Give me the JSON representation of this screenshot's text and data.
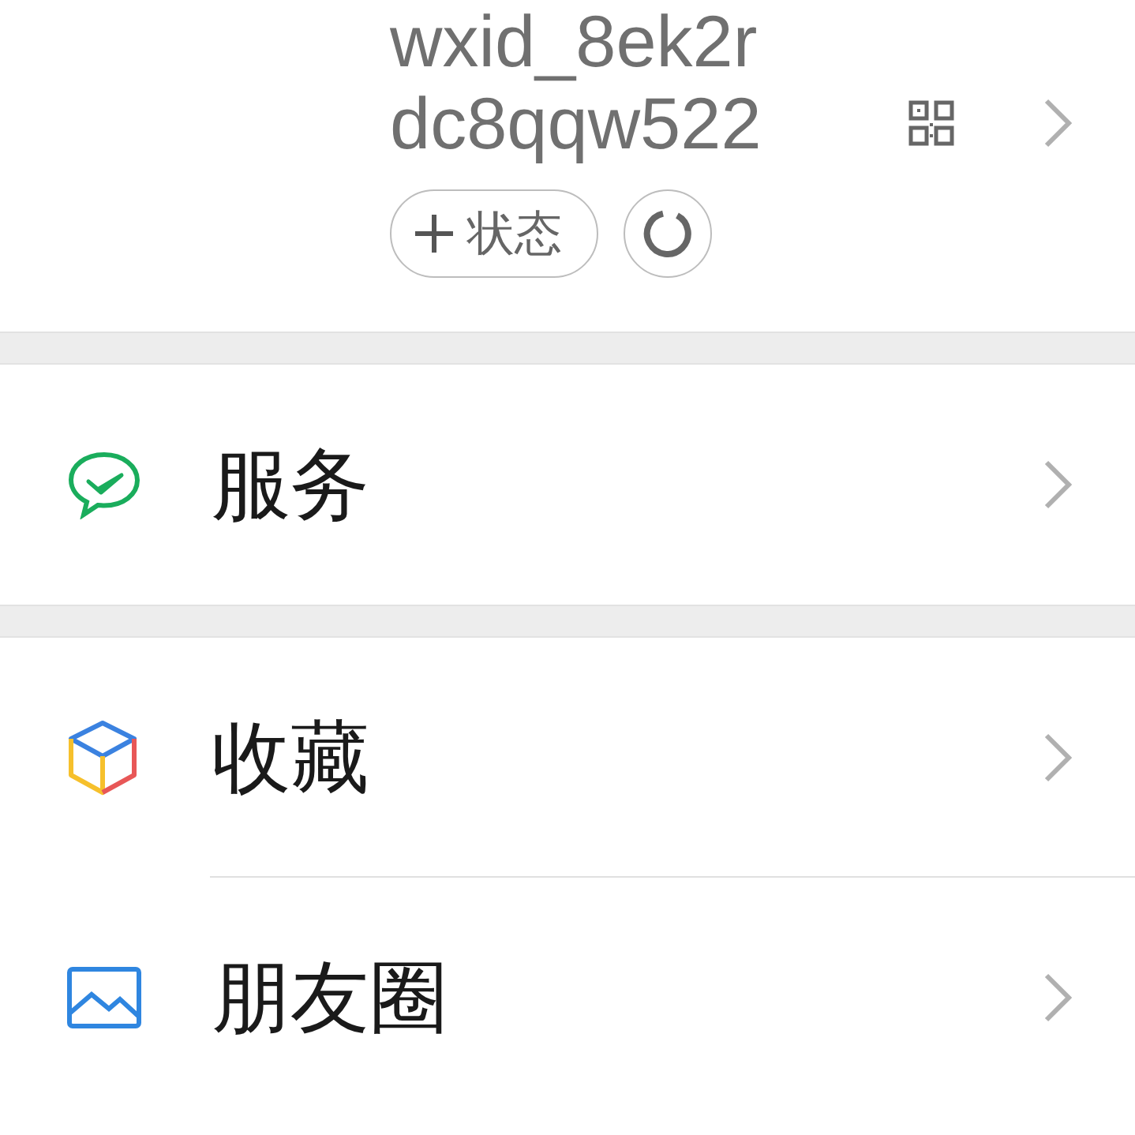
{
  "profile": {
    "id_lines": [
      "wxid_8ek2r",
      "dc8qqw522"
    ],
    "status_button": {
      "label": "状态"
    }
  },
  "sections": [
    {
      "items": [
        {
          "label": "服务",
          "kind": "services"
        }
      ]
    },
    {
      "items": [
        {
          "label": "收藏",
          "kind": "favorites"
        },
        {
          "label": "朋友圈",
          "kind": "moments"
        }
      ]
    }
  ]
}
